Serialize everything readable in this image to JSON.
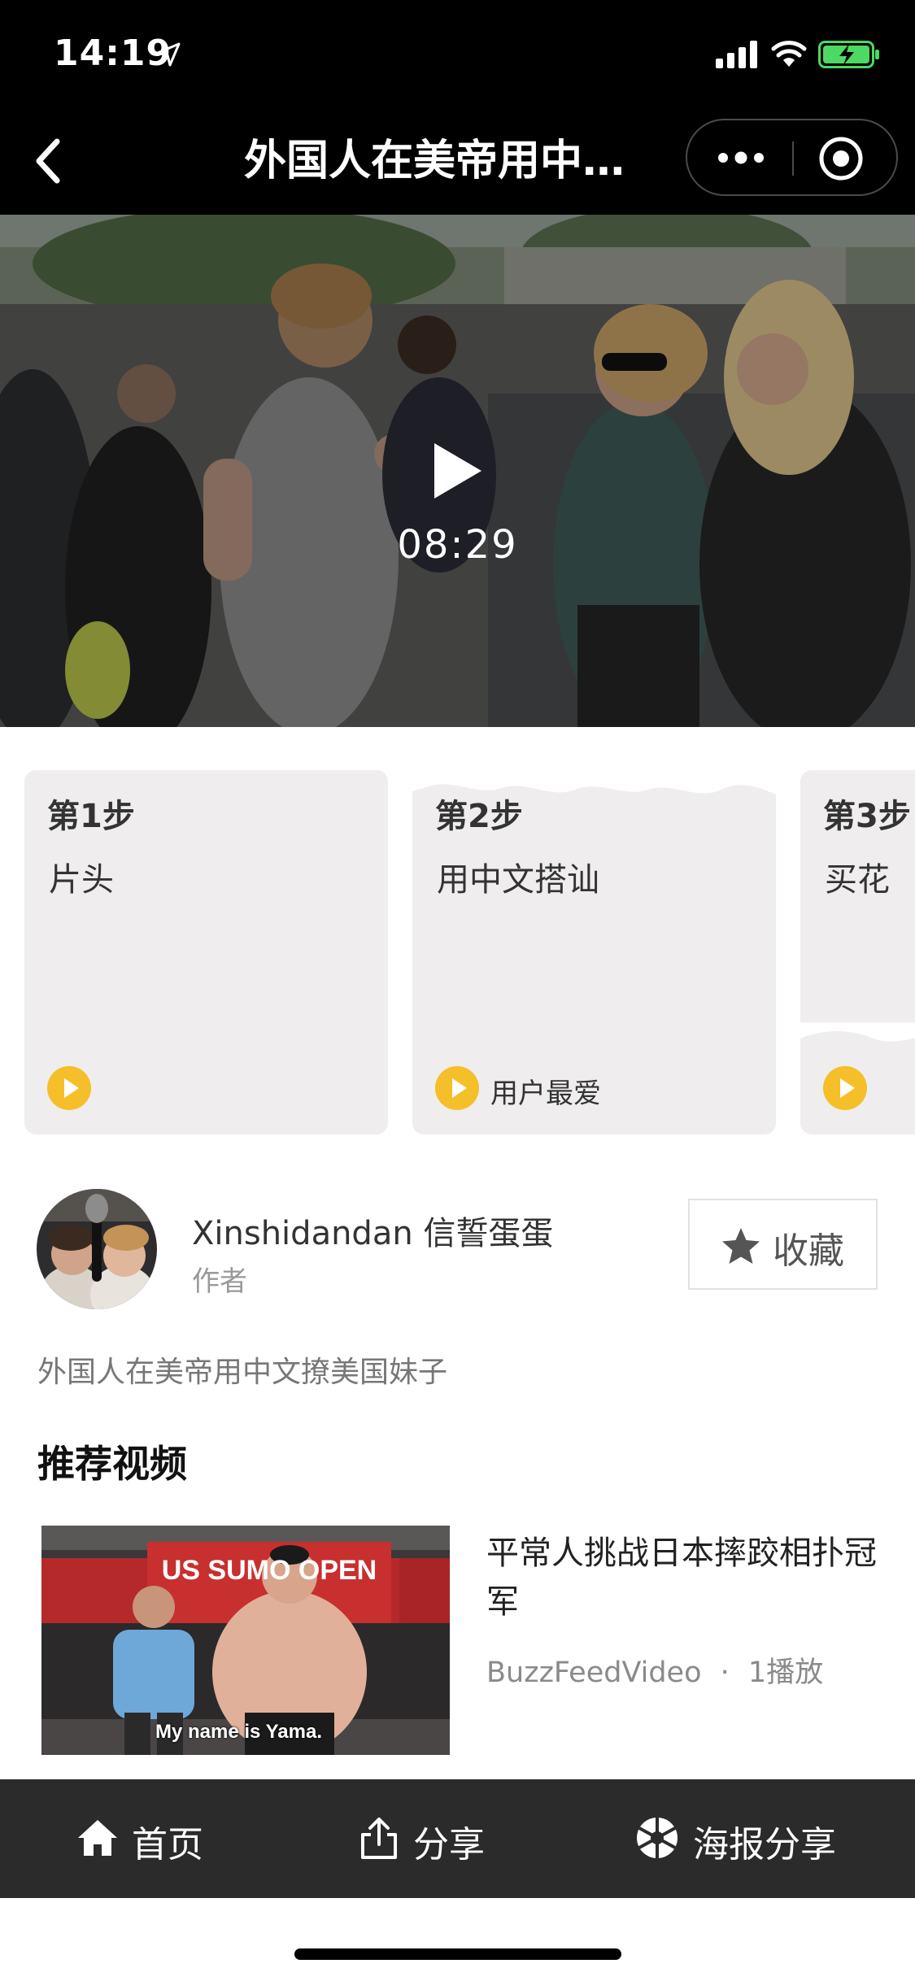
{
  "status_bar": {
    "time": "14:19"
  },
  "nav": {
    "title": "外国人在美帝用中…"
  },
  "video": {
    "duration": "08:29"
  },
  "steps": [
    {
      "num": "第1步",
      "name": "片头",
      "tag": ""
    },
    {
      "num": "第2步",
      "name": "用中文搭讪",
      "tag": "用户最爱"
    },
    {
      "num": "第3步",
      "name": "买花",
      "tag": ""
    }
  ],
  "author": {
    "name": "Xinshidandan 信誓蛋蛋",
    "role": "作者"
  },
  "favorite": {
    "label": "收藏"
  },
  "description": "外国人在美帝用中文撩美国妹子",
  "recommended": {
    "heading": "推荐视频",
    "items": [
      {
        "title": "平常人挑战日本摔跤相扑冠军",
        "channel": "BuzzFeedVideo",
        "separator": "·",
        "plays": "1播放",
        "thumb_banner": "US SUMO OPEN",
        "thumb_caption": "My name is Yama."
      }
    ]
  },
  "tabbar": {
    "home": "首页",
    "share": "分享",
    "poster": "海报分享"
  },
  "colors": {
    "accent": "#f5bf2a",
    "battery": "#4cd964",
    "tabbar": "#2b2b2b",
    "card": "#efeded"
  }
}
